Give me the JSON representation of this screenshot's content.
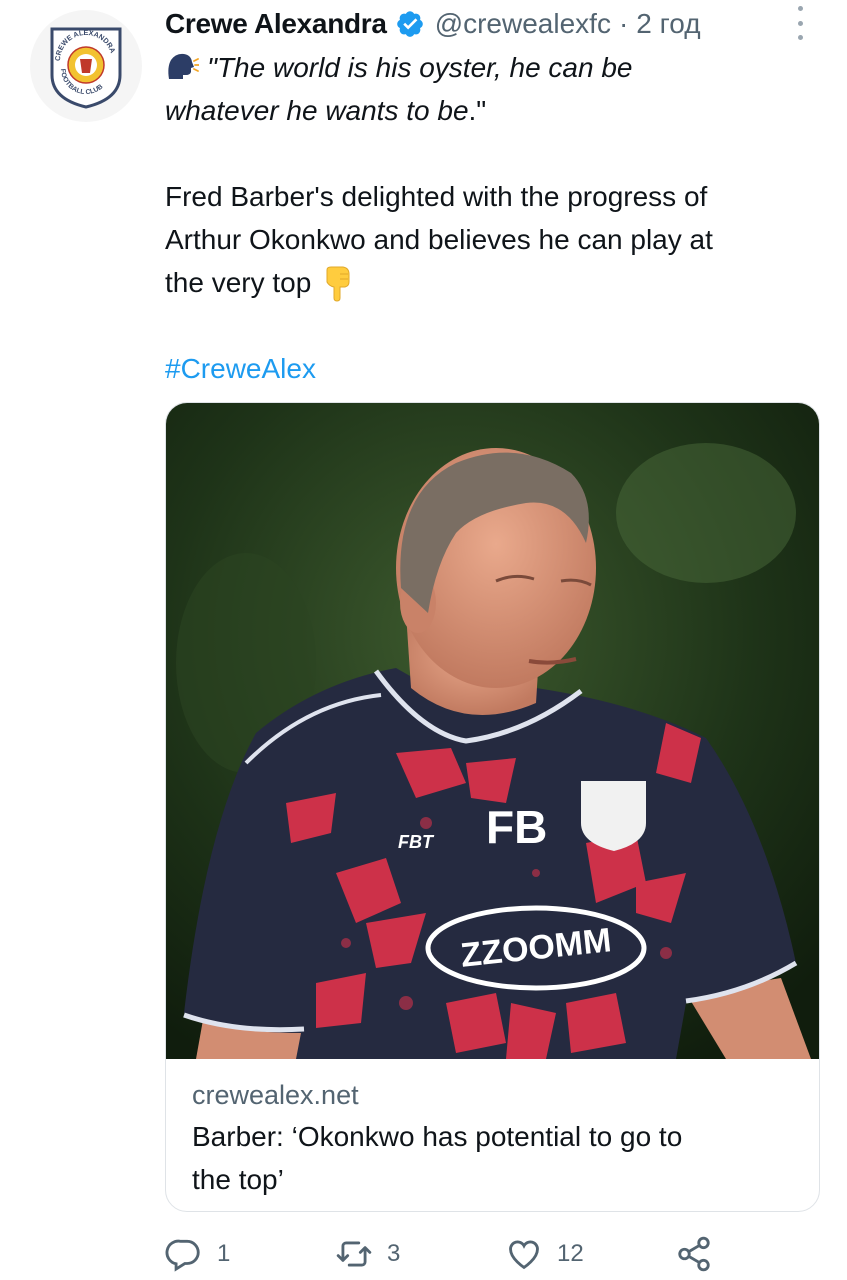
{
  "account": {
    "display_name": "Crewe Alexandra",
    "handle": "@crewealexfc",
    "separator": "·",
    "time": "2 год",
    "verified": true,
    "avatar_icon": "crewe-alexandra-crest-icon",
    "avatar_text_top": "CREWE ALEXANDRA",
    "avatar_text_bottom": "FOOTBALL CLUB"
  },
  "tweet": {
    "quote_line1": "\"The world is his oyster, he can be",
    "quote_line2_italic": "whatever he wants to be",
    "quote_line2_tail": ".\"",
    "body_line1": "Fred Barber's delighted with the progress of",
    "body_line2": "Arthur Okonkwo and believes he can play at",
    "body_line3": "the very top",
    "hashtag": "#CreweAlex",
    "emoji_start": "speaking-head-icon",
    "emoji_end": "pointing-down-icon"
  },
  "card": {
    "image_icon": "photo-man-in-training-shirt",
    "shirt_initials": "FB",
    "shirt_sponsor": "ZZOOMM",
    "shirt_maker": "FBT",
    "domain": "crewealex.net",
    "title_line1": "Barber: ‘Okonkwo has potential to go to",
    "title_line2": "the top’"
  },
  "actions": {
    "reply_count": "1",
    "retweet_count": "3",
    "like_count": "12"
  },
  "colors": {
    "link": "#1d9bf0",
    "secondary_text": "#536471",
    "verified_badge": "#1d9bf0",
    "shirt_navy": "#252a40",
    "shirt_red": "#e0324a"
  }
}
